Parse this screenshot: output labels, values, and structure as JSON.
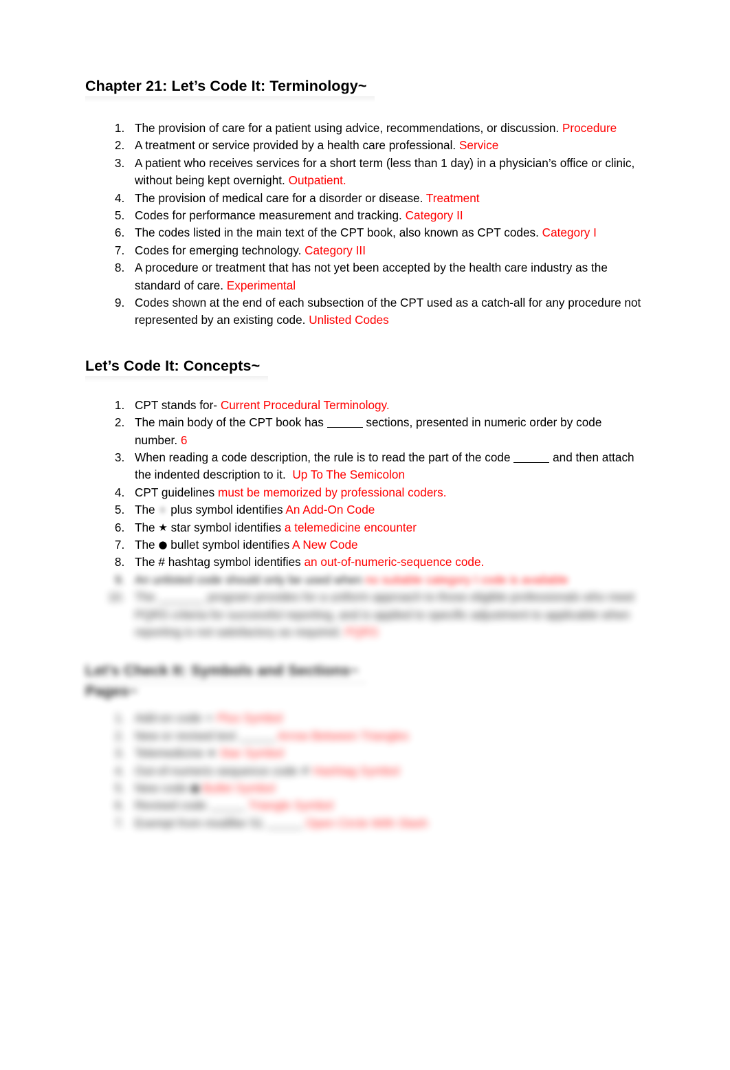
{
  "document": {
    "section1": {
      "heading": "Chapter 21: Let’s Code It: Terminology~",
      "items": [
        {
          "num": "1.",
          "q": "The provision of care for a patient using advice, recommendations, or discussion.",
          "a": "Procedure"
        },
        {
          "num": "2.",
          "q": "A treatment or service provided by a health care professional.",
          "a": "Service"
        },
        {
          "num": "3.",
          "q": "A patient who receives services for a short term (less than 1 day) in a physician’s office or clinic, without being kept overnight.",
          "a": "Outpatient."
        },
        {
          "num": "4.",
          "q": "The provision of medical care for a disorder or disease.",
          "a": "Treatment"
        },
        {
          "num": "5.",
          "q": "Codes for performance measurement and tracking.",
          "a": "Category II"
        },
        {
          "num": "6.",
          "q": "The codes listed in the main text of the CPT book, also known as CPT codes.",
          "a": "Category I"
        },
        {
          "num": "7.",
          "q": " Codes for emerging technology.",
          "a": "Category III"
        },
        {
          "num": "8.",
          "q": " A procedure or treatment that has not yet been accepted by the health care industry as the standard of care.",
          "a": "Experimental"
        },
        {
          "num": "9.",
          "q": " Codes shown at the end of each subsection of the CPT used as a catch-all for any procedure not represented by an existing code.",
          "a": "Unlisted Codes"
        }
      ]
    },
    "section2": {
      "heading": "Let’s Code It: Concepts~",
      "item1": {
        "pre": "CPT stands for-",
        "a": "Current Procedural Terminology."
      },
      "item2": {
        "pre": "The main body of the CPT book has",
        "post": "sections, presented in numeric order by code number.",
        "a": "6"
      },
      "item3": {
        "pre": "When reading a code description, the rule is to read the part of the code",
        "post": "and then attach the indented description to it.",
        "a": "Up To The Semicolon"
      },
      "item4": {
        "pre": "CPT guidelines",
        "a": "must be memorized by professional coders."
      },
      "item5": {
        "pre": "The",
        "symbol": "plus-symbol",
        "mid": "plus symbol identifies",
        "a": "An Add-On Code"
      },
      "item6": {
        "pre": "The",
        "symbol": "★",
        "mid": "star symbol identifies",
        "a": "a telemedicine encounter"
      },
      "item7": {
        "pre": "The",
        "symbol": "●",
        "mid": "bullet symbol identifies",
        "a": "A New Code"
      },
      "item8": {
        "pre": "The # hashtag symbol identifies",
        "a": "an out-of-numeric-sequence code."
      },
      "item9_blurred": {
        "q": "An unlisted code should only be used when",
        "a": "no suitable category I code is available",
        "note": "blurred"
      },
      "item10_blurred": {
        "q": "The _______ program provides for a uniform approach to those eligible professionals who meet PQRS criteria for successful reporting, and is applied to specific adjustment to applicable when reporting is not satisfactory as required.",
        "a": "PQRS",
        "note": "blurred"
      }
    },
    "section3_blurred": {
      "heading": "Let’s Check It: Symbols and Sections~",
      "subheading": "Pages~",
      "items": [
        {
          "q": "Add-on code",
          "mark": "+",
          "a": "Plus Symbol"
        },
        {
          "q": "New or revised text",
          "mark": "",
          "a": "Arrow Between Triangles"
        },
        {
          "q": "Telemedicine",
          "mark": "★",
          "a": "Star Symbol"
        },
        {
          "q": "Out-of-numeric-sequence code",
          "mark": "#",
          "a": "Hashtag Symbol"
        },
        {
          "q": "New code",
          "mark": "●",
          "a": "Bullet Symbol"
        },
        {
          "q": "Revised code",
          "mark": "",
          "a": "Triangle Symbol"
        },
        {
          "q": "Exempt from modifier 51",
          "mark": "",
          "a": "Open Circle With Slash"
        }
      ],
      "note": "bottom content obscured by blur"
    },
    "colors": {
      "answer_red": "#FF0000",
      "text_black": "#000000",
      "page_background": "#FFFFFF"
    }
  }
}
